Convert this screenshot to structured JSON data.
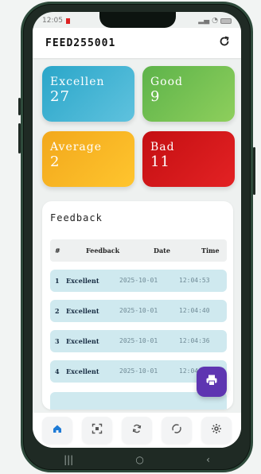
{
  "status_bar": {
    "time": "12:05",
    "icons_right": "signal-wifi-battery"
  },
  "header": {
    "title": "FEED255001",
    "refresh_icon": "refresh-icon"
  },
  "cards": {
    "excellent": {
      "label": "Excellen",
      "count": "27",
      "color": "#2aa6c9"
    },
    "good": {
      "label": "Good",
      "count": "9",
      "color": "#5db34a"
    },
    "average": {
      "label": "Average",
      "count": "2",
      "color": "#f2a81c"
    },
    "bad": {
      "label": "Bad",
      "count": "11",
      "color": "#c40f12"
    }
  },
  "feedback_panel": {
    "title": "Feedback",
    "columns": [
      "#",
      "Feedback",
      "Date",
      "Time"
    ],
    "rows": [
      {
        "num": "1",
        "feedback": "Excellent",
        "date": "2025-10-01",
        "time": "12:04:53"
      },
      {
        "num": "2",
        "feedback": "Excellent",
        "date": "2025-10-01",
        "time": "12:04:40"
      },
      {
        "num": "3",
        "feedback": "Excellent",
        "date": "2025-10-01",
        "time": "12:04:36"
      },
      {
        "num": "4",
        "feedback": "Excellent",
        "date": "2025-10-01",
        "time": "12:04"
      }
    ]
  },
  "fab": {
    "icon": "print-icon",
    "color": "#5e35b1"
  },
  "bottom_nav": {
    "items": [
      "home-icon",
      "qr-scan-icon",
      "sync-icon",
      "circle-arrows-icon",
      "settings-gear-icon"
    ],
    "active_color": "#1e7bd6"
  }
}
